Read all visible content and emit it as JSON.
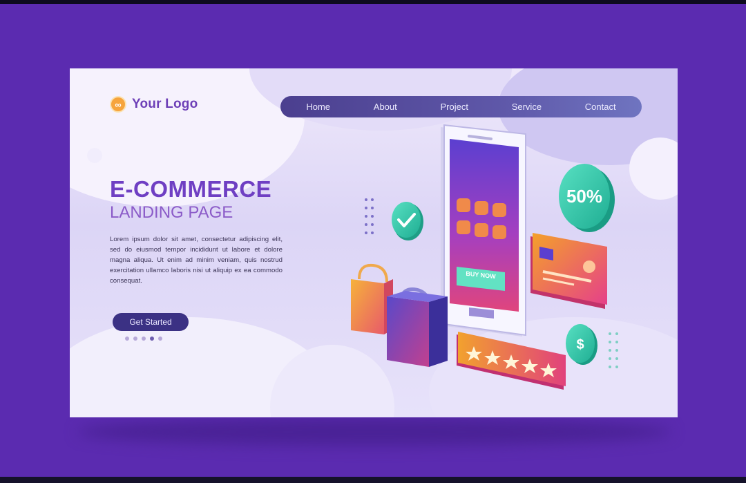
{
  "logo": {
    "text": "Your Logo",
    "icon": "coin-icon"
  },
  "nav": {
    "items": [
      "Home",
      "About",
      "Project",
      "Service",
      "Contact"
    ]
  },
  "hero": {
    "title": "E-COMMERCE",
    "subtitle": "LANDING PAGE",
    "paragraph": "Lorem ipsum dolor sit amet, consectetur adipiscing elit, sed do eiusmod tempor incididunt ut labore et dolore magna aliqua. Ut enim ad minim veniam, quis nostrud exercitation ullamco laboris nisi ut aliquip ex ea commodo consequat.",
    "cta": "Get Started",
    "pager": {
      "count": 5,
      "active": 4
    }
  },
  "illustration": {
    "discount": "50%",
    "coin": "$",
    "phone_button": "BUY NOW",
    "rating_stars": 5,
    "icons": [
      "checkmark-icon",
      "shopping-bag-icon",
      "credit-card-icon",
      "star-icon"
    ]
  },
  "colors": {
    "page_bg": "#5b2bb0",
    "accent": "#6f3fc3",
    "nav_bg": "#4b3f8f",
    "teal": "#31c9a9"
  }
}
